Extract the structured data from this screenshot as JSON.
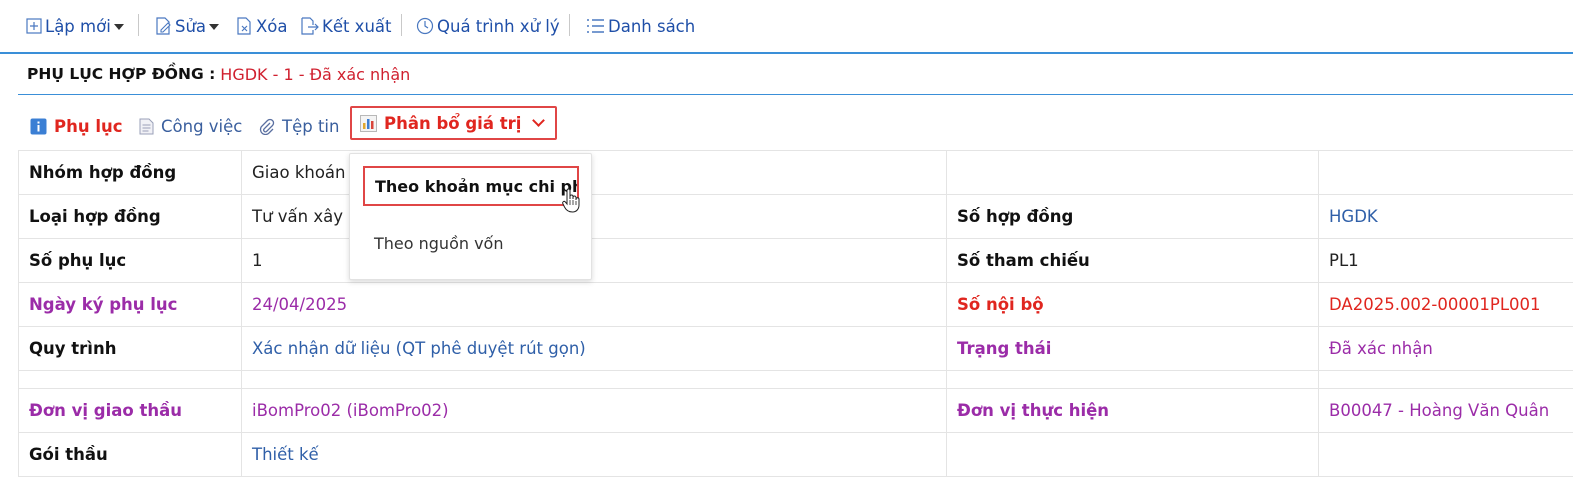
{
  "toolbar": {
    "new_label": "Lập mới",
    "edit_label": "Sửa",
    "delete_label": "Xóa",
    "export_label": "Kết xuất",
    "process_label": "Quá trình xử lý",
    "list_label": "Danh sách"
  },
  "title": {
    "label": "PHỤ LỤC HỢP ĐỒNG :",
    "value": "HGDK - 1 - Đã xác nhận"
  },
  "tabs": {
    "appendix": "Phụ lục",
    "tasks": "Công việc",
    "files": "Tệp tin",
    "allocation": "Phân bổ giá trị"
  },
  "dropdown": {
    "items": [
      "Theo khoản mục chi phí",
      "Theo nguồn vốn"
    ]
  },
  "fields": {
    "contract_group_label": "Nhóm hợp đồng",
    "contract_group_value": "Giao khoán",
    "contract_type_label": "Loại hợp đồng",
    "contract_type_value": "Tư vấn xây dựng",
    "contract_no_label": "Số hợp đồng",
    "contract_no_value": "HGDK",
    "appendix_no_label": "Số phụ lục",
    "appendix_no_value": "1",
    "reference_no_label": "Số tham chiếu",
    "reference_no_value": "PL1",
    "sign_date_label": "Ngày ký phụ lục",
    "sign_date_value": "24/04/2025",
    "internal_no_label": "Số nội bộ",
    "internal_no_value": "DA2025.002-00001PL001",
    "workflow_label": "Quy trình",
    "workflow_value": "Xác nhận dữ liệu (QT phê duyệt rút gọn)",
    "status_label": "Trạng thái",
    "status_value": "Đã xác nhận",
    "contractor_unit_label": "Đơn vị giao thầu",
    "contractor_unit_value": "iBomPro02 (iBomPro02)",
    "executing_unit_label": "Đơn vị thực hiện",
    "executing_unit_value": "B00047 - Hoàng Văn Quân",
    "package_label": "Gói thầu",
    "package_value": "Thiết kế"
  },
  "colors": {
    "accent_blue": "#3a8fd8",
    "link_blue": "#1f4fa8",
    "red": "#e0261f",
    "purple": "#9b2ca8"
  },
  "icons": [
    "plus-square-icon",
    "edit-doc-icon",
    "delete-doc-icon",
    "export-icon",
    "clock-icon",
    "list-icon",
    "info-icon",
    "document-icon",
    "paperclip-icon",
    "bar-chart-icon",
    "hand-cursor-icon"
  ]
}
